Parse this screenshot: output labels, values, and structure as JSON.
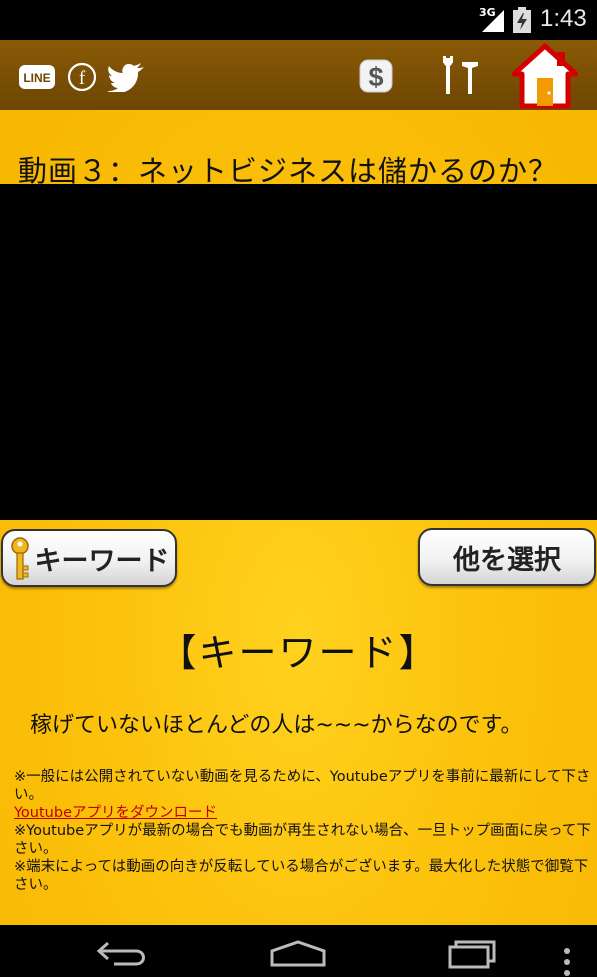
{
  "status_bar": {
    "network": "3G",
    "time": "1:43"
  },
  "toolbar": {
    "line_label": "LINE",
    "facebook_label": "f",
    "dollar_label": "$"
  },
  "video": {
    "title": "動画３：ネットビジネスは儲かるのか？"
  },
  "buttons": {
    "keyword": "キーワード",
    "other": "他を選択"
  },
  "keyword_section": {
    "heading": "【キーワード】",
    "text": "稼げていないほとんどの人は~~~からなのです。"
  },
  "notes": {
    "note1": "※一般には公開されていない動画を見るために、Youtubeアプリを事前に最新にして下さい。",
    "download_link": "Youtubeアプリをダウンロード",
    "note2": "※Youtubeアプリが最新の場合でも動画が再生されない場合、一旦トップ画面に戻って下さい。",
    "note3": "※端末によっては動画の向きが反転している場合がございます。最大化した状態で御覧下さい。"
  },
  "colors": {
    "background_yellow": "#fcc20c",
    "toolbar_brown": "#7a5005",
    "link_red": "#c00000"
  }
}
